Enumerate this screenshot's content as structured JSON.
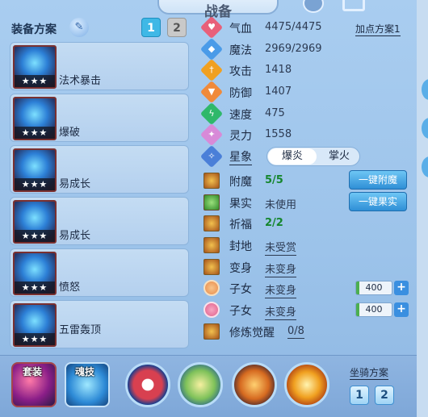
{
  "header": {
    "title": "战备"
  },
  "equipment": {
    "title": "装备方案",
    "tabs": [
      "1",
      "2"
    ],
    "active_tab": "1",
    "items": [
      {
        "name": "法术暴击",
        "stars": "★★★"
      },
      {
        "name": "爆破",
        "stars": "★★★"
      },
      {
        "name": "易成长",
        "stars": "★★★"
      },
      {
        "name": "易成长",
        "stars": "★★★"
      },
      {
        "name": "愤怒",
        "stars": "★★★"
      },
      {
        "name": "五雷轰顶",
        "stars": "★★★"
      }
    ]
  },
  "stats": {
    "point_scheme": "加点方案1",
    "rows": [
      {
        "label": "气血",
        "value": "4475/4475",
        "color": "#e8607a"
      },
      {
        "label": "魔法",
        "value": "2969/2969",
        "color": "#4a9be8"
      },
      {
        "label": "攻击",
        "value": "1418",
        "color": "#f0a020"
      },
      {
        "label": "防御",
        "value": "1407",
        "color": "#f08a3a"
      },
      {
        "label": "速度",
        "value": "475",
        "color": "#2fb86a"
      },
      {
        "label": "灵力",
        "value": "1558",
        "color": "#d88ad8"
      }
    ],
    "star_sign": {
      "label": "星象",
      "options": [
        "爆炎",
        "掌火"
      ],
      "selected": "爆炎"
    }
  },
  "features": [
    {
      "label": "附魔",
      "value": "5/5",
      "button": "一键附魔"
    },
    {
      "label": "果实",
      "value": "未使用",
      "button": "一键果实"
    },
    {
      "label": "祈福",
      "value": "2/2"
    },
    {
      "label": "封地",
      "value": "未受赏"
    },
    {
      "label": "变身",
      "value": "未变身"
    },
    {
      "label": "子女",
      "value": "未变身",
      "qty": "400"
    },
    {
      "label": "子女",
      "value": "未变身",
      "qty": "400"
    },
    {
      "label": "修炼觉醒",
      "value": "0/8"
    }
  ],
  "bottom": {
    "skill_labels": [
      "套装",
      "魂技"
    ],
    "mount_title": "坐骑方案",
    "mount_tabs": [
      "1",
      "2"
    ]
  }
}
